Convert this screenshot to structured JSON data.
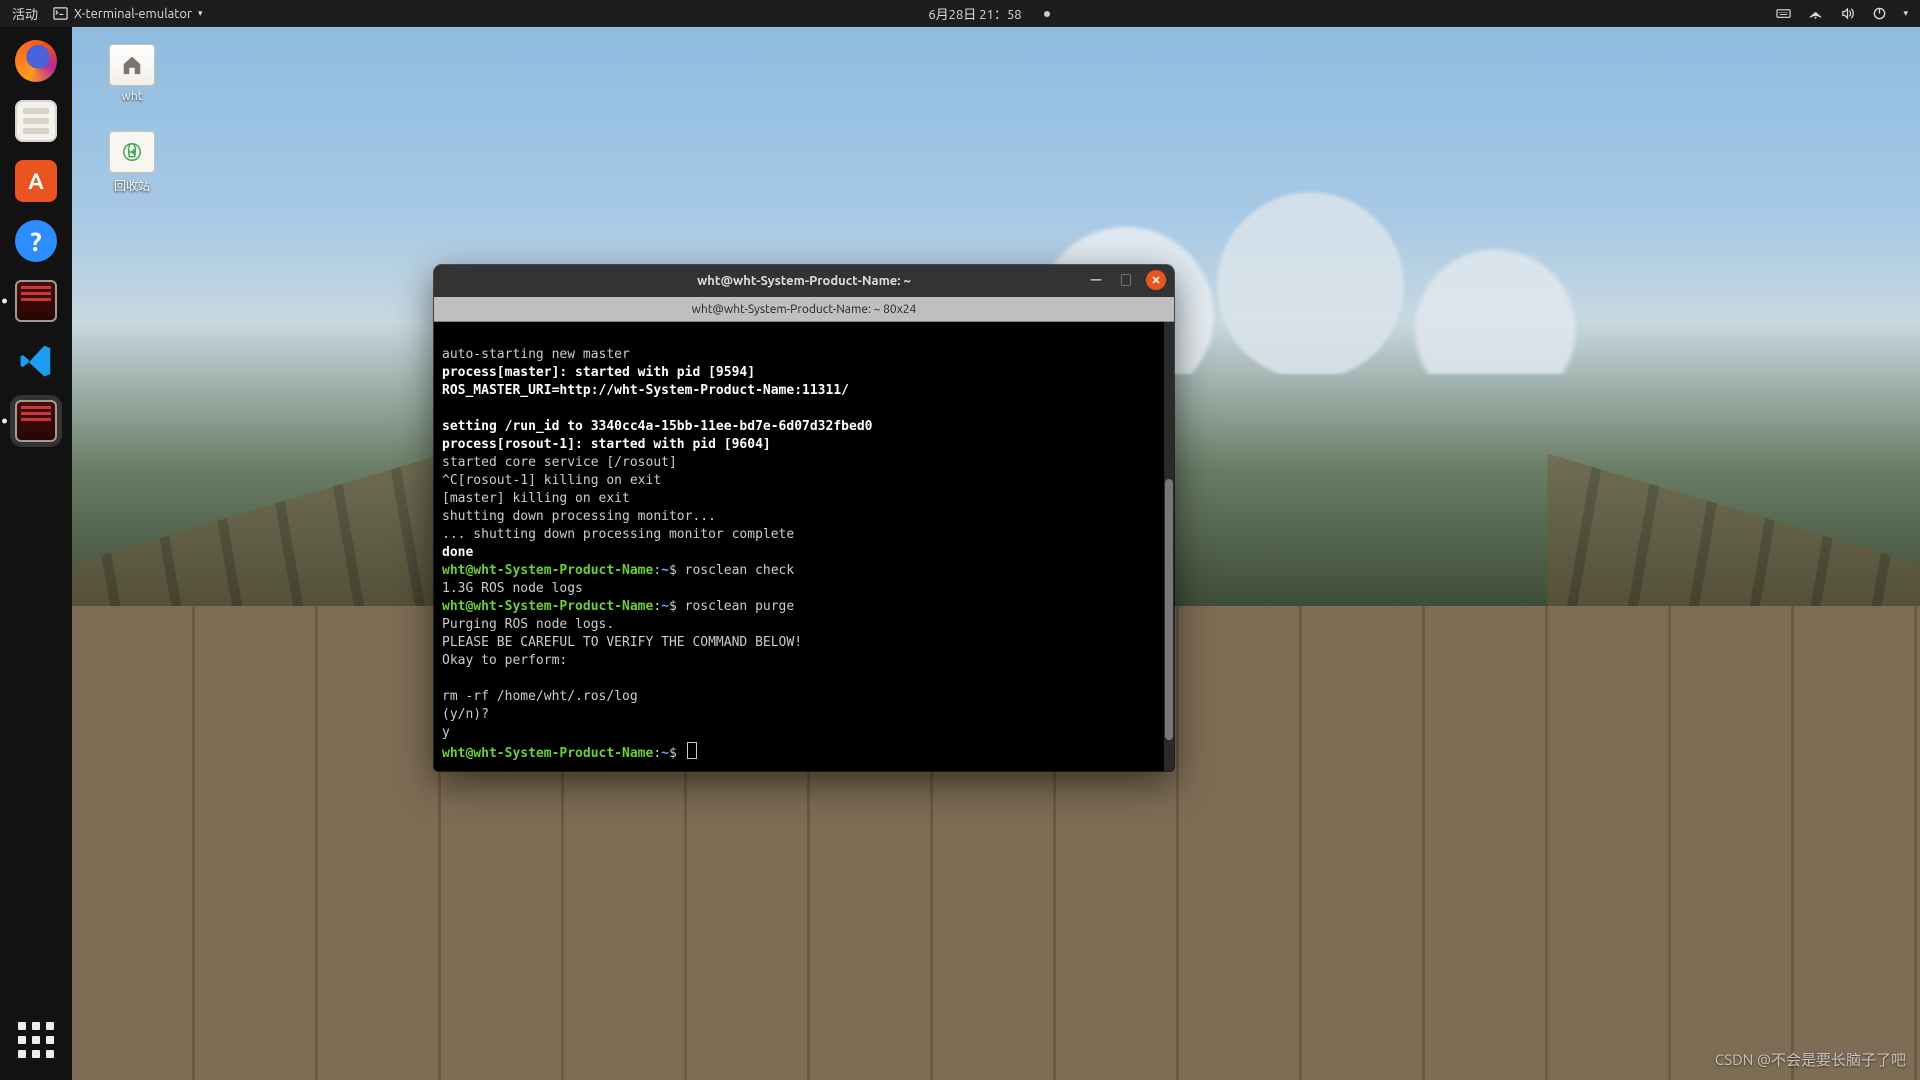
{
  "topbar": {
    "activities": "活动",
    "app_menu": "X-terminal-emulator",
    "clock": "6月28日 21：58"
  },
  "dock": {
    "items": [
      {
        "name": "firefox",
        "running": false
      },
      {
        "name": "files",
        "running": false
      },
      {
        "name": "ubuntu-software",
        "running": false
      },
      {
        "name": "help",
        "running": false
      },
      {
        "name": "terminal-1",
        "running": true
      },
      {
        "name": "vscode",
        "running": false
      },
      {
        "name": "terminal-2",
        "running": true,
        "active": true
      }
    ]
  },
  "desktop": {
    "home_label": "wht",
    "trash_label": "回收站"
  },
  "terminal": {
    "title": "wht@wht-System-Product-Name: ~",
    "tab_label": "wht@wht-System-Product-Name: ~ 80x24",
    "prompt_user": "wht@wht-System-Product-Name",
    "prompt_sep": ":",
    "prompt_path": "~",
    "prompt_tail": "$ ",
    "lines": {
      "l0": "",
      "l1": "auto-starting new master",
      "l2": "process[master]: started with pid [9594]",
      "l3": "ROS_MASTER_URI=http://wht-System-Product-Name:11311/",
      "l4": "",
      "l5": "setting /run_id to 3340cc4a-15bb-11ee-bd7e-6d07d32fbed0",
      "l6": "process[rosout-1]: started with pid [9604]",
      "l7": "started core service [/rosout]",
      "l8": "^C[rosout-1] killing on exit",
      "l9": "[master] killing on exit",
      "l10": "shutting down processing monitor...",
      "l11": "... shutting down processing monitor complete",
      "l12": "done",
      "cmd1": "rosclean check",
      "l14": "1.3G ROS node logs",
      "cmd2": "rosclean purge",
      "l16": "Purging ROS node logs.",
      "l17": "PLEASE BE CAREFUL TO VERIFY THE COMMAND BELOW!",
      "l18": "Okay to perform:",
      "l19": "",
      "l20": "rm -rf /home/wht/.ros/log",
      "l21": "(y/n)?",
      "l22": "y"
    }
  },
  "watermark": "CSDN @不会是要长脑子了吧"
}
